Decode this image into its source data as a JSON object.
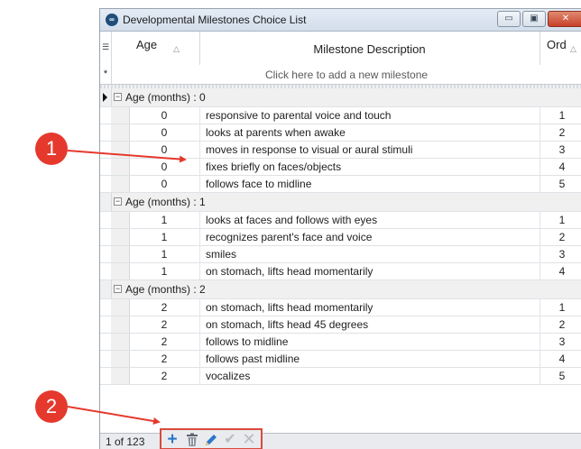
{
  "window": {
    "title": "Developmental Milestones Choice List",
    "minimize_glyph": "▭",
    "maximize_glyph": "▣",
    "close_glyph": "✕",
    "app_icon_glyph": "∞"
  },
  "grid": {
    "columns": {
      "age": "Age",
      "description": "Milestone Description",
      "ord": "Ord"
    },
    "new_row_text": "Click here to add a new milestone",
    "new_row_marker": "*",
    "groups": [
      {
        "label": "Age (months) : 0",
        "rows": [
          {
            "age": "0",
            "description": "responsive to parental voice and touch",
            "ord": "1"
          },
          {
            "age": "0",
            "description": "looks at parents when awake",
            "ord": "2"
          },
          {
            "age": "0",
            "description": "moves in response to visual or aural stimuli",
            "ord": "3"
          },
          {
            "age": "0",
            "description": "fixes briefly on faces/objects",
            "ord": "4"
          },
          {
            "age": "0",
            "description": "follows face to midline",
            "ord": "5"
          }
        ]
      },
      {
        "label": "Age (months) : 1",
        "rows": [
          {
            "age": "1",
            "description": "looks at faces and follows with eyes",
            "ord": "1"
          },
          {
            "age": "1",
            "description": "recognizes parent's face and voice",
            "ord": "2"
          },
          {
            "age": "1",
            "description": "smiles",
            "ord": "3"
          },
          {
            "age": "1",
            "description": "on stomach, lifts head momentarily",
            "ord": "4"
          }
        ]
      },
      {
        "label": "Age (months) : 2",
        "rows": [
          {
            "age": "2",
            "description": "on stomach, lifts head momentarily",
            "ord": "1"
          },
          {
            "age": "2",
            "description": "on stomach, lifts head 45 degrees",
            "ord": "2"
          },
          {
            "age": "2",
            "description": "follows to midline",
            "ord": "3"
          },
          {
            "age": "2",
            "description": "follows past midline",
            "ord": "4"
          },
          {
            "age": "2",
            "description": "vocalizes",
            "ord": "5"
          }
        ]
      }
    ]
  },
  "footer": {
    "record_count": "1 of 123",
    "toolbar": {
      "add_icon": "+",
      "delete_icon": "🗑",
      "edit_icon": "✎",
      "save_icon": "✔",
      "cancel_icon": "✕"
    }
  },
  "callouts": [
    "1",
    "2"
  ],
  "colors": {
    "callout": "#e5392d",
    "toolbar_border": "#d94a3d",
    "add_icon": "#2a77c9"
  }
}
